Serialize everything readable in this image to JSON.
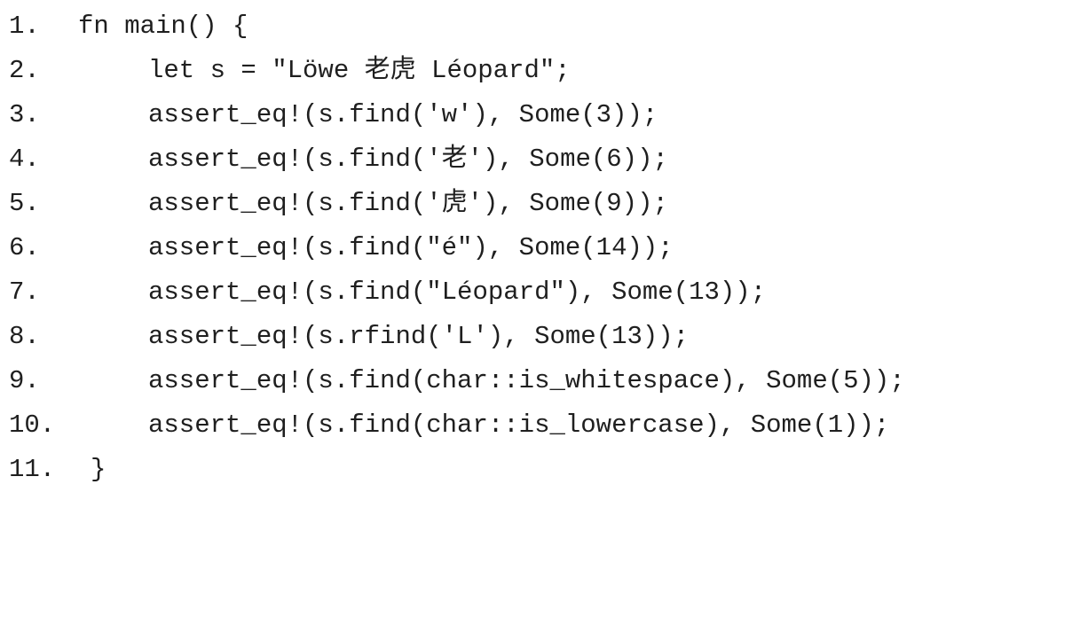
{
  "code_lines": [
    {
      "num": "1.",
      "text": "fn main() {"
    },
    {
      "num": "2.",
      "text": "let s = \"Löwe 老虎 Léopard\";"
    },
    {
      "num": "3.",
      "text": "assert_eq!(s.find('w'), Some(3));"
    },
    {
      "num": "4.",
      "text": "assert_eq!(s.find('老'), Some(6));"
    },
    {
      "num": "5.",
      "text": "assert_eq!(s.find('虎'), Some(9));"
    },
    {
      "num": "6.",
      "text": "assert_eq!(s.find(\"é\"), Some(14));"
    },
    {
      "num": "7.",
      "text": "assert_eq!(s.find(\"Léopard\"), Some(13));"
    },
    {
      "num": "8.",
      "text": "assert_eq!(s.rfind('L'), Some(13));"
    },
    {
      "num": "9.",
      "text": "assert_eq!(s.find(char::is_whitespace), Some(5));"
    },
    {
      "num": "10.",
      "text": "assert_eq!(s.find(char::is_lowercase), Some(1));"
    },
    {
      "num": "11.",
      "text": "}"
    }
  ]
}
